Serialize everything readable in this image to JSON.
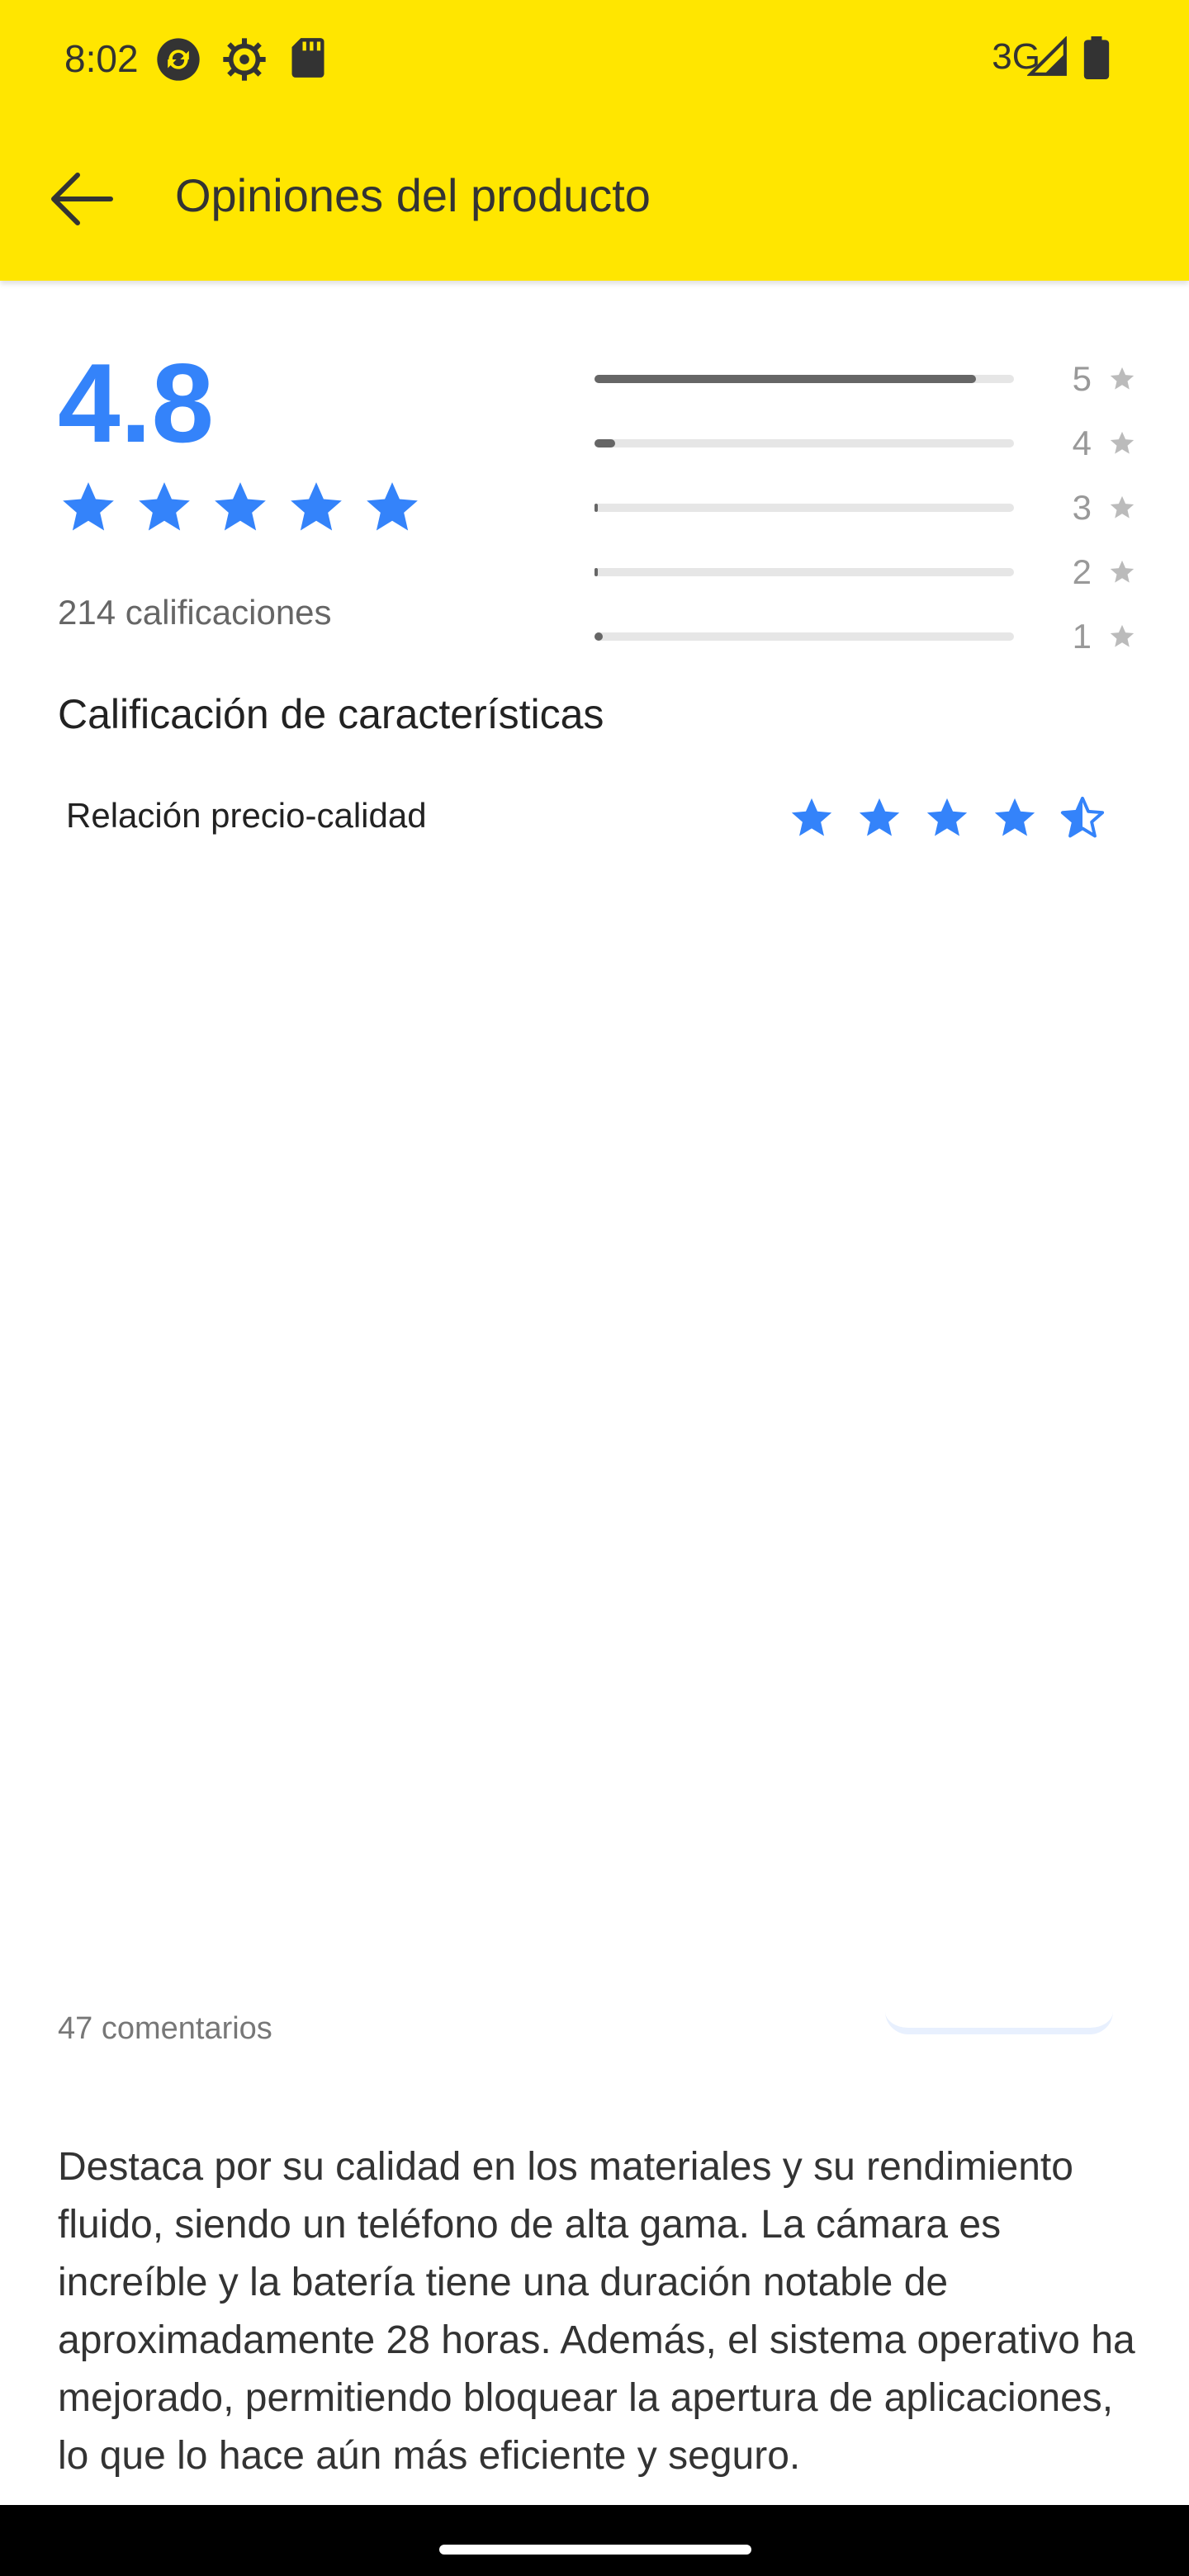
{
  "status_bar": {
    "time": "8:02",
    "network": "3G",
    "icons": [
      "sync-icon",
      "settings-gear-icon",
      "sd-card-icon",
      "signal-icon",
      "battery-icon"
    ]
  },
  "app_bar": {
    "title": "Opiniones del producto",
    "back_icon": "arrow-back-icon",
    "color": "#FFE600"
  },
  "summary": {
    "average": "4.8",
    "stars": 4.8,
    "ratings_count": "214 calificaciones",
    "accent": "#3483FA"
  },
  "distribution": [
    {
      "label": "5",
      "fraction": 0.91
    },
    {
      "label": "4",
      "fraction": 0.05
    },
    {
      "label": "3",
      "fraction": 0.005
    },
    {
      "label": "2",
      "fraction": 0.005
    },
    {
      "label": "1",
      "fraction": 0.02
    }
  ],
  "features": {
    "title": "Calificación de características",
    "items": [
      {
        "label": "Relación precio-calidad",
        "stars": 4.5
      }
    ]
  },
  "comments": {
    "count_label": "47 comentarios"
  },
  "review": {
    "text": "Destaca por su calidad en los materiales y su rendimiento fluido, siendo un teléfono de alta gama. La cámara es increíble y la batería tiene una duración notable de aproximadamente 28 horas. Además, el sistema operativo ha mejorado, permitiendo bloquear la apertura de aplicaciones, lo que lo hace aún más eficiente y seguro."
  }
}
